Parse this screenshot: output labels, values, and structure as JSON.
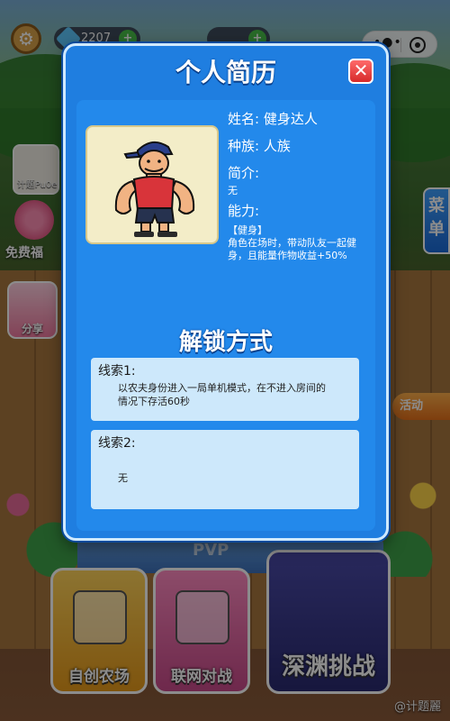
{
  "background": {
    "res_value": "2207",
    "side_avatar_name": "计题Pu0e",
    "side_gift_label": "免费福",
    "side_share_label": "分享",
    "menu_tab_label": "菜单",
    "event_tag_label": "活动",
    "pvp_label": "PVP",
    "mode_cards": [
      "自创农场",
      "联网对战",
      "深渊挑战"
    ],
    "watermark": "@计题麗"
  },
  "modal": {
    "title": "个人简历",
    "close_icon": "close-icon",
    "name_label": "姓名:",
    "name_value": "健身达人",
    "race_label": "种族:",
    "race_value": "人族",
    "intro_label": "简介:",
    "intro_value": "无",
    "ability_label": "能力:",
    "ability_title": "【健身】",
    "ability_desc": "角色在场时，带动队友一起健身，且能量作物收益+50%",
    "unlock_title": "解锁方式",
    "clues": [
      {
        "label": "线索1:",
        "text": "以农夫身份进入一局单机模式，在不进入房间的情况下存活60秒"
      },
      {
        "label": "线索2:",
        "text": "无"
      }
    ]
  },
  "colors": {
    "modal_bg": "#1f7ee0",
    "clue_bg": "#cde8fb",
    "close_red": "#d62a2a"
  }
}
